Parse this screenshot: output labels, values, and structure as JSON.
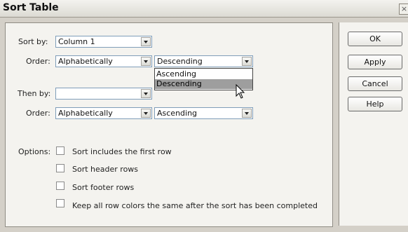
{
  "window": {
    "title": "Sort Table",
    "close_glyph": "×"
  },
  "sort_by": {
    "label": "Sort by:",
    "value": "Column 1"
  },
  "order1": {
    "label": "Order:",
    "type_value": "Alphabetically",
    "direction_value": "Descending"
  },
  "dropdown": {
    "options": [
      "Ascending",
      "Descending"
    ],
    "highlighted": "Descending"
  },
  "then_by": {
    "label": "Then by:",
    "value": ""
  },
  "order2": {
    "label": "Order:",
    "type_value": "Alphabetically",
    "direction_value": "Ascending"
  },
  "options": {
    "label": "Options:",
    "items": [
      {
        "label": "Sort includes the first row",
        "checked": false
      },
      {
        "label": "Sort header rows",
        "checked": false
      },
      {
        "label": "Sort footer rows",
        "checked": false
      },
      {
        "label": "Keep all row colors the same after the sort has been completed",
        "checked": false
      }
    ]
  },
  "buttons": {
    "ok": "OK",
    "apply": "Apply",
    "cancel": "Cancel",
    "help": "Help"
  }
}
